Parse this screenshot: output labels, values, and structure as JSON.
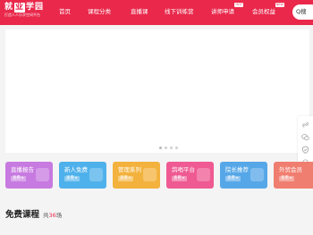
{
  "header": {
    "logo": {
      "part1": "就",
      "part2": "业",
      "part3": "学园",
      "tagline": "打造人人乐学空间平台"
    },
    "nav": [
      {
        "label": "首页"
      },
      {
        "label": "课程分类"
      },
      {
        "label": "直播课"
      },
      {
        "label": "线下训练营"
      },
      {
        "label": "讲师申请",
        "badge": "HOT"
      },
      {
        "label": "会员权益",
        "badge": "NEW"
      }
    ],
    "search_label": "Q搜"
  },
  "banner": {
    "slides_count": 4,
    "active_index": 0
  },
  "float_bar": {
    "icons": [
      "link-icon",
      "wechat-icon",
      "shield-icon",
      "headset-icon"
    ],
    "top_label": "TOP"
  },
  "categories": [
    {
      "title": "直播报告",
      "tag": "查看 ▸",
      "color": "#c77ae0"
    },
    {
      "title": "新人免费",
      "tag": "查看 ▸",
      "color": "#4fb1eb"
    },
    {
      "title": "管理系列",
      "tag": "查看 ▸",
      "color": "#f3b23d"
    },
    {
      "title": "鸽哨平台",
      "tag": "查看 ▸",
      "color": "#ef5a92"
    },
    {
      "title": "院长推荐",
      "tag": "查看 ▸",
      "color": "#56a7e8"
    },
    {
      "title": "外贸会员",
      "tag": "查看 ▸",
      "color": "#f07e70"
    }
  ],
  "section": {
    "title": "免费课程",
    "count_prefix": "共",
    "count_value": "36",
    "count_suffix": "场"
  },
  "colors": {
    "brand": "#e9284b",
    "page_bg": "#f4f4f4"
  }
}
